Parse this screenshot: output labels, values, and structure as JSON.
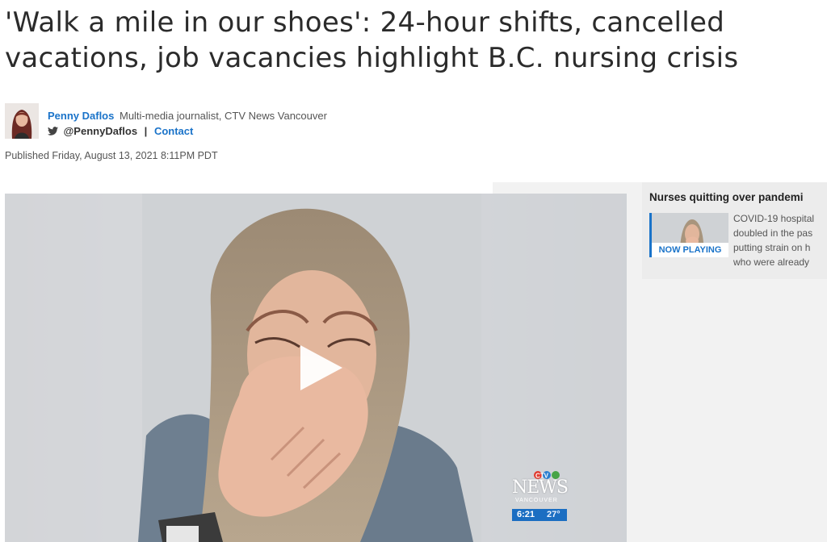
{
  "article": {
    "headline_line1": "'Walk a mile in our shoes': 24-hour shifts, cancelled",
    "headline_line2": "vacations, job vacancies highlight B.C. nursing crisis",
    "author": {
      "name": "Penny Daflos",
      "role": "Multi-media journalist, CTV News Vancouver",
      "twitter": "@PennyDaflos",
      "separator": "|",
      "contact": "Contact"
    },
    "published": "Published Friday, August 13, 2021 8:11PM PDT"
  },
  "video": {
    "overlay": {
      "logo_top": "CTV",
      "logo_main": "NEWS",
      "logo_city": "VANCOUVER",
      "time": "6:21",
      "temperature": "27°"
    },
    "play_icon": "play-icon"
  },
  "playlist": {
    "title": "Nurses quitting over pandemi",
    "now_playing": "NOW PLAYING",
    "description_lines": [
      "COVID-19 hospital",
      "doubled in the pas",
      "putting strain on h",
      "who were already"
    ]
  },
  "colors": {
    "link": "#1a73c9",
    "headline": "#2b2b2b",
    "sidebar_bg": "#ececec"
  }
}
